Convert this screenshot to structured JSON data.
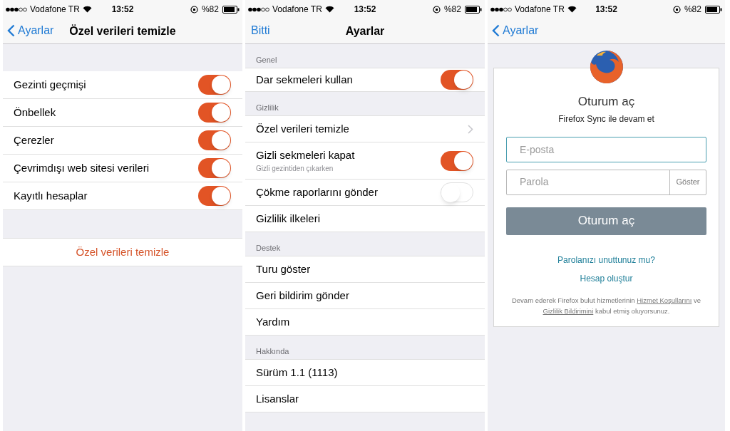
{
  "screens": [
    {
      "kind": "clear",
      "status": {
        "carrier": "Vodafone TR",
        "time": "13:52",
        "battery": "%82"
      },
      "nav": {
        "left": "Ayarlar",
        "back": true,
        "title": "Özel verileri temizle"
      },
      "rows": [
        {
          "label": "Gezinti geçmişi",
          "on": true
        },
        {
          "label": "Önbellek",
          "on": true
        },
        {
          "label": "Çerezler",
          "on": true
        },
        {
          "label": "Çevrimdışı web sitesi verileri",
          "on": true
        },
        {
          "label": "Kayıtlı hesaplar",
          "on": true
        }
      ],
      "action": "Özel verileri temizle"
    },
    {
      "kind": "settings",
      "status": {
        "carrier": "Vodafone TR",
        "time": "13:52",
        "battery": "%82"
      },
      "nav": {
        "left": "Bitti",
        "back": false,
        "title": "Ayarlar"
      },
      "sections": [
        {
          "header": "Genel",
          "rows": [
            {
              "kind": "toggle",
              "label": "Dar sekmeleri kullan",
              "on": true
            }
          ]
        },
        {
          "header": "Gizlilik",
          "rows": [
            {
              "kind": "link",
              "label": "Özel verileri temizle"
            },
            {
              "kind": "toggle",
              "label": "Gizli sekmeleri kapat",
              "subtitle": "Gizli gezintiden çıkarken",
              "on": true
            },
            {
              "kind": "toggle",
              "label": "Çökme raporlarını gönder",
              "on": false
            },
            {
              "kind": "plain",
              "label": "Gizlilik ilkeleri"
            }
          ]
        },
        {
          "header": "Destek",
          "rows": [
            {
              "kind": "plain",
              "label": "Turu göster"
            },
            {
              "kind": "plain",
              "label": "Geri bildirim gönder"
            },
            {
              "kind": "plain",
              "label": "Yardım"
            }
          ]
        },
        {
          "header": "Hakkında",
          "rows": [
            {
              "kind": "plain",
              "label": "Sürüm 1.1 (1113)"
            },
            {
              "kind": "plain",
              "label": "Lisanslar"
            }
          ]
        }
      ]
    },
    {
      "kind": "login",
      "status": {
        "carrier": "Vodafone TR",
        "time": "13:52",
        "battery": "%82"
      },
      "nav": {
        "left": "Ayarlar",
        "back": true
      },
      "title": "Oturum aç",
      "subtitle": "Firefox Sync ile devam et",
      "email": {
        "placeholder": "E-posta"
      },
      "password": {
        "placeholder": "Parola",
        "reveal": "Göster"
      },
      "submit": "Oturum aç",
      "forgot": "Parolanızı unuttunuz mu?",
      "create": "Hesap oluştur",
      "terms": [
        {
          "kind": "text",
          "text": "Devam ederek Firefox bulut hizmetlerinin "
        },
        {
          "kind": "link",
          "text": "Hizmet Koşullarını"
        },
        {
          "kind": "text",
          "text": " ve "
        },
        {
          "kind": "link",
          "text": "Gizlilik Bildirimini"
        },
        {
          "kind": "text",
          "text": " kabul etmiş oluyorsunuz."
        }
      ]
    }
  ]
}
